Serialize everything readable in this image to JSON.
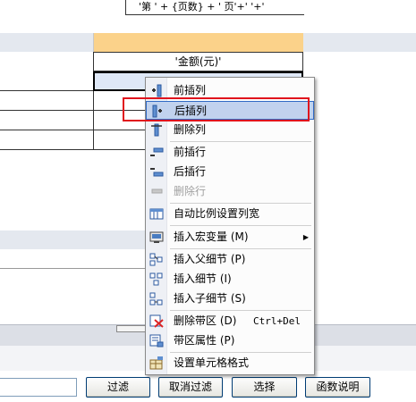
{
  "top_cell_text": "'第 ' + {页数} + ' 页'+' '+'",
  "amount_header": "'金额(元)'",
  "selected_cell_text": "[",
  "menu": {
    "items": [
      {
        "label": "前插列",
        "icon": "insert-column-before-icon",
        "enabled": true
      },
      {
        "label": "后插列",
        "icon": "insert-column-after-icon",
        "enabled": true,
        "highlighted": true
      },
      {
        "label": "删除列",
        "icon": "delete-column-icon",
        "enabled": true
      },
      {
        "label": "前插行",
        "icon": "insert-row-before-icon",
        "enabled": true
      },
      {
        "label": "后插行",
        "icon": "insert-row-after-icon",
        "enabled": true
      },
      {
        "label": "删除行",
        "icon": "delete-row-icon",
        "enabled": false
      },
      {
        "label": "自动比例设置列宽",
        "icon": "auto-column-width-icon",
        "enabled": true
      },
      {
        "label": "插入宏变量 (M)",
        "icon": "insert-macro-variable-icon",
        "enabled": true,
        "submenu": true
      },
      {
        "label": "插入父细节 (P)",
        "icon": "insert-parent-detail-icon",
        "enabled": true
      },
      {
        "label": "插入细节 (I)",
        "icon": "insert-detail-icon",
        "enabled": true
      },
      {
        "label": "插入子细节 (S)",
        "icon": "insert-child-detail-icon",
        "enabled": true
      },
      {
        "label": "删除带区 (D)",
        "icon": "delete-band-icon",
        "enabled": true,
        "shortcut": "Ctrl+Del"
      },
      {
        "label": "带区属性 (P)",
        "icon": "band-properties-icon",
        "enabled": true
      },
      {
        "label": "设置单元格格式",
        "icon": "cell-format-icon",
        "enabled": true
      }
    ]
  },
  "buttons": {
    "filter": "过滤",
    "cancel_filter": "取消过滤",
    "select": "选择",
    "function_help": "函数说明"
  },
  "colors": {
    "highlight": "#c1d2ee",
    "header_orange": "#fbd28a",
    "callout_red": "#e0141d"
  }
}
